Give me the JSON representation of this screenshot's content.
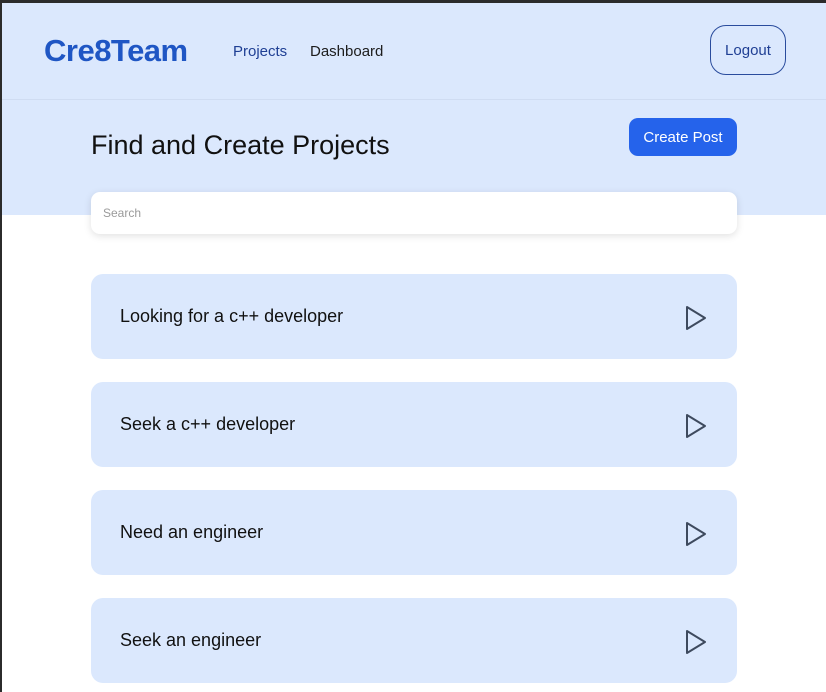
{
  "brand": {
    "logo_text": "Cre8Team"
  },
  "nav": {
    "projects_label": "Projects",
    "dashboard_label": "Dashboard",
    "logout_label": "Logout"
  },
  "hero": {
    "title": "Find and Create Projects",
    "create_post_label": "Create Post"
  },
  "search": {
    "placeholder": "Search",
    "value": ""
  },
  "projects": [
    {
      "title": "Looking for a c++ developer",
      "icon": "play-icon"
    },
    {
      "title": "Seek a c++ developer",
      "icon": "play-icon"
    },
    {
      "title": "Need an engineer",
      "icon": "play-icon"
    },
    {
      "title": "Seek an engineer",
      "icon": "play-icon"
    }
  ],
  "colors": {
    "accent": "#2563eb",
    "panel": "#dbe8fd",
    "brand": "#1f56c4"
  }
}
